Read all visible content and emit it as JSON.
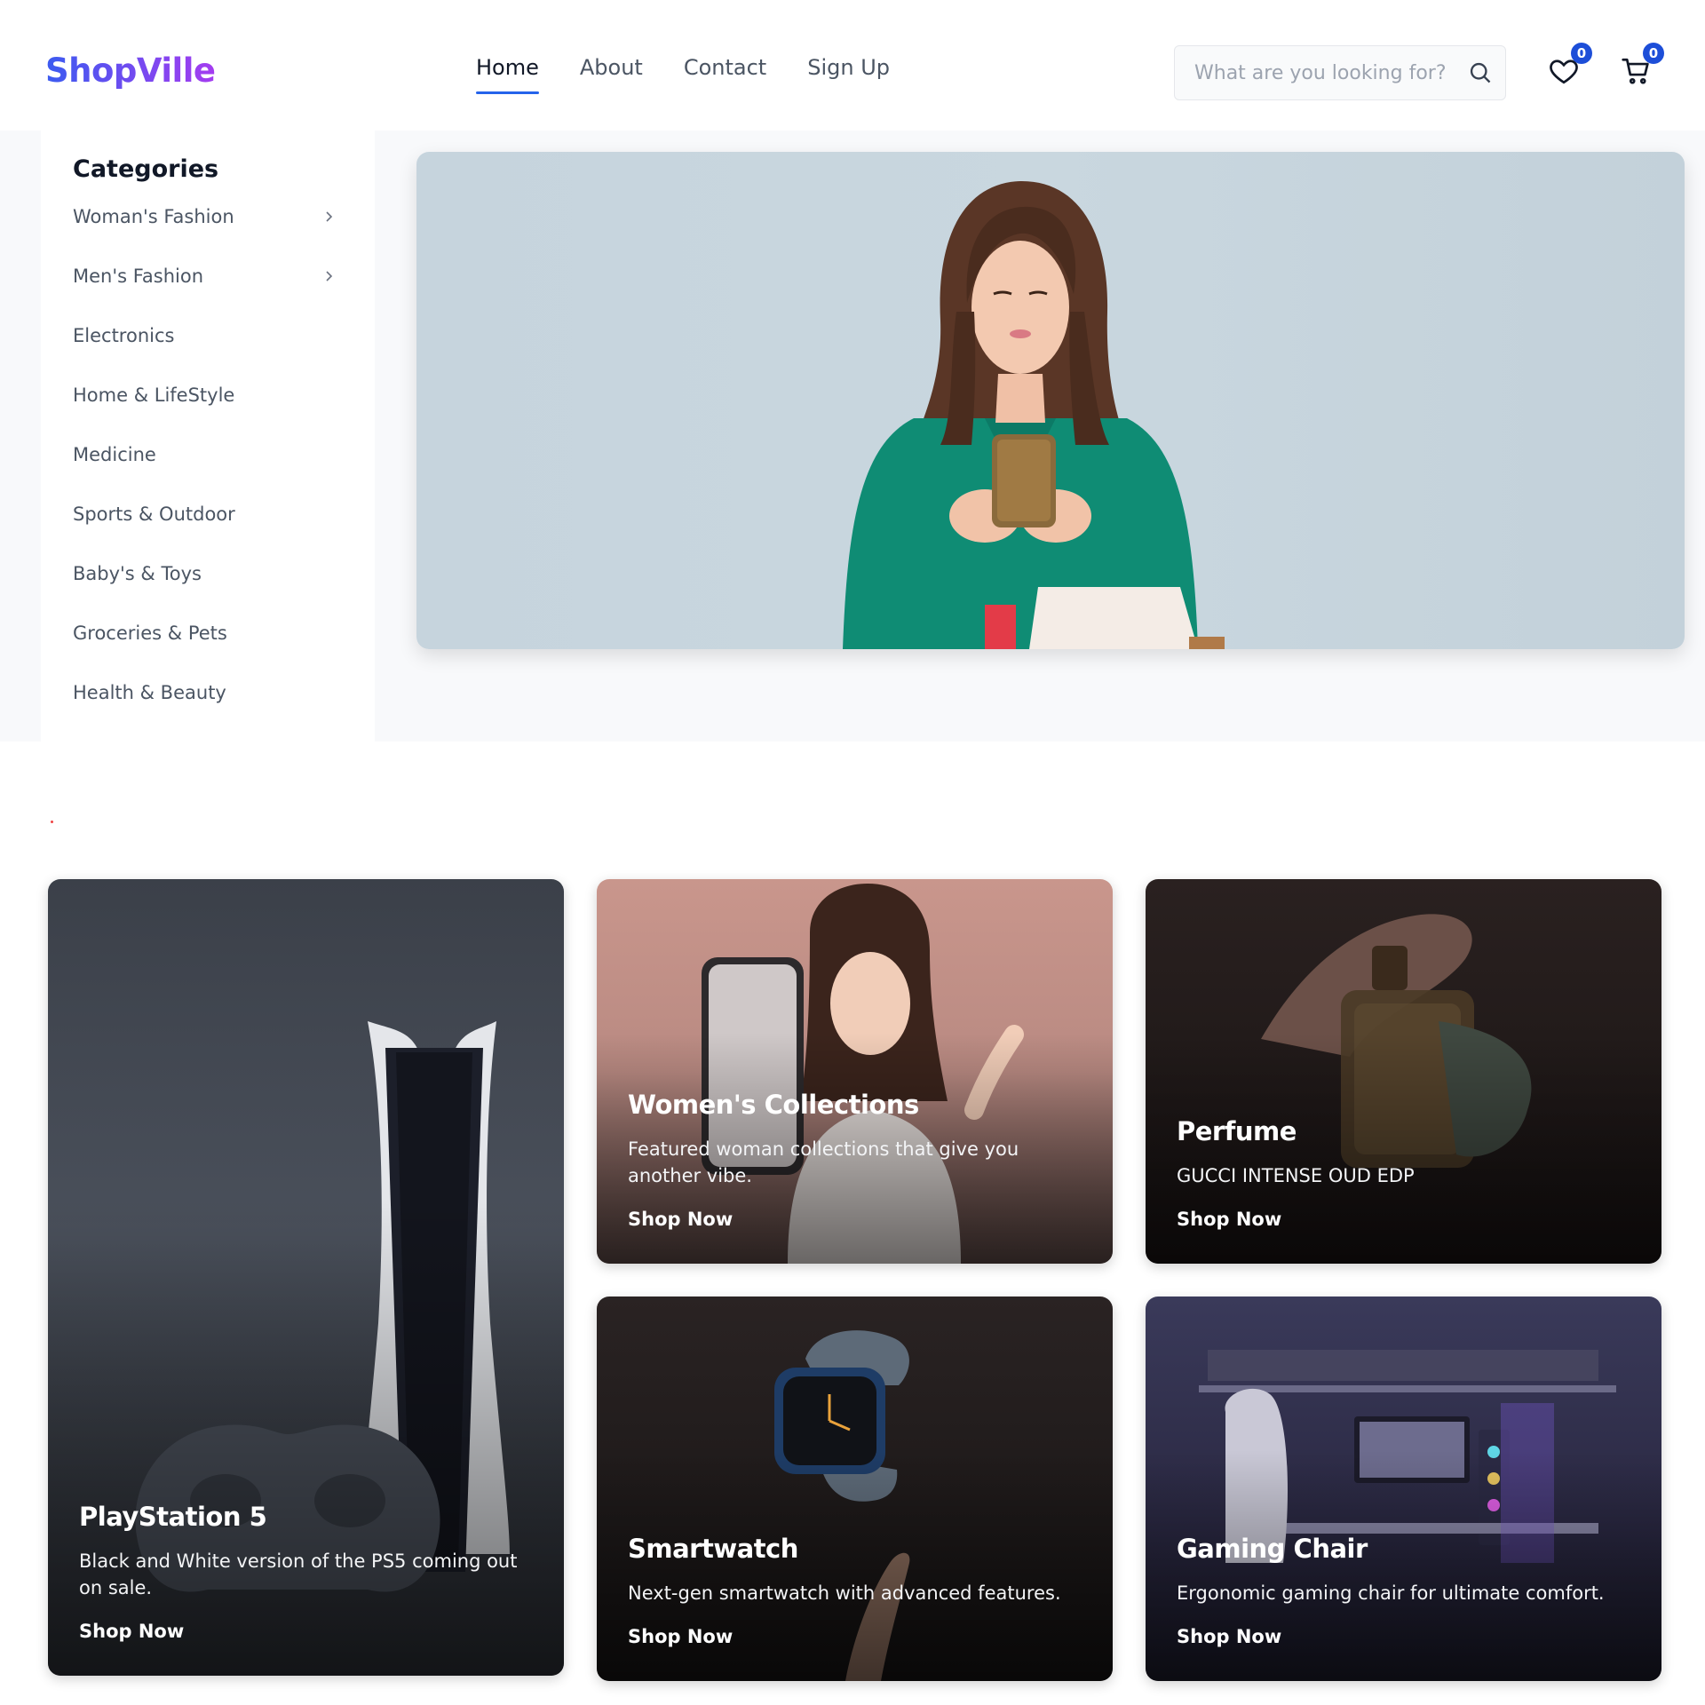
{
  "header": {
    "logo": "ShopVille",
    "nav": [
      "Home",
      "About",
      "Contact",
      "Sign Up"
    ],
    "active_nav": "Home",
    "search_placeholder": "What are you looking for?",
    "wishlist_count": "0",
    "cart_count": "0"
  },
  "sidebar": {
    "title": "Categories",
    "items": [
      {
        "label": "Woman's Fashion",
        "has_submenu": true
      },
      {
        "label": "Men's Fashion",
        "has_submenu": true
      },
      {
        "label": "Electronics",
        "has_submenu": false
      },
      {
        "label": "Home & LifeStyle",
        "has_submenu": false
      },
      {
        "label": "Medicine",
        "has_submenu": false
      },
      {
        "label": "Sports & Outdoor",
        "has_submenu": false
      },
      {
        "label": "Baby's & Toys",
        "has_submenu": false
      },
      {
        "label": "Groceries & Pets",
        "has_submenu": false
      },
      {
        "label": "Health & Beauty",
        "has_submenu": false
      }
    ]
  },
  "promos": {
    "ps5": {
      "title": "PlayStation 5",
      "desc": "Black and White version of the PS5 coming out on sale.",
      "cta": "Shop Now"
    },
    "women": {
      "title": "Women's Collections",
      "desc": "Featured woman collections that give you another vibe.",
      "cta": "Shop Now"
    },
    "perfume": {
      "title": "Perfume",
      "desc": "GUCCI INTENSE OUD EDP",
      "cta": "Shop Now"
    },
    "watch": {
      "title": "Smartwatch",
      "desc": "Next-gen smartwatch with advanced features.",
      "cta": "Shop Now"
    },
    "chair": {
      "title": "Gaming Chair",
      "desc": "Ergonomic gaming chair for ultimate comfort.",
      "cta": "Shop Now"
    }
  },
  "colors": {
    "accent": "#2563eb",
    "badge": "#1d4ed8",
    "logo_start": "#3b5bf0",
    "logo_end": "#a53cf0"
  }
}
